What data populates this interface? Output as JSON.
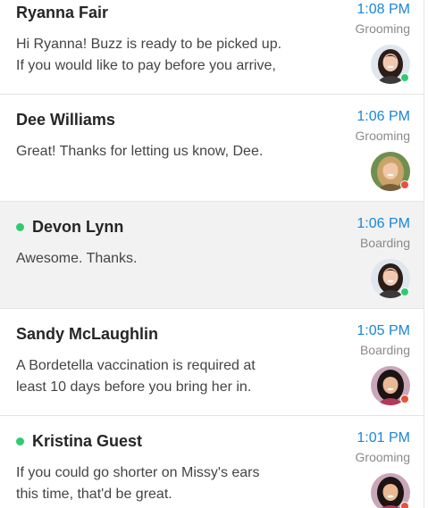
{
  "threads": [
    {
      "name": "Ryanna Fair",
      "time": "1:08 PM",
      "department": "Grooming",
      "message_line1": "Hi Ryanna! Buzz is ready to be picked up.",
      "message_line2": "If you would like to pay before you arrive,",
      "unread": false,
      "presence": "online",
      "skin_color": "#f2c9b0",
      "hair_color": "#2b1d17",
      "bg_color": "#dfe6ee"
    },
    {
      "name": "Dee Williams",
      "time": "1:06 PM",
      "department": "Grooming",
      "message_line1": "Great! Thanks for letting us know, Dee.",
      "message_line2": "",
      "unread": false,
      "presence": "offline",
      "skin_color": "#f0c8a8",
      "hair_color": "#c9a36a",
      "bg_color": "#6f8f4e"
    },
    {
      "name": "Devon Lynn",
      "time": "1:06 PM",
      "department": "Boarding",
      "message_line1": "Awesome. Thanks.",
      "message_line2": "",
      "unread": true,
      "presence": "online",
      "skin_color": "#f2c9b0",
      "hair_color": "#2b1d17",
      "bg_color": "#dfe6ee"
    },
    {
      "name": "Sandy McLaughlin",
      "time": "1:05 PM",
      "department": "Boarding",
      "message_line1": "A Bordetella vaccination is required at",
      "message_line2": "least 10 days before you bring her in.",
      "unread": false,
      "presence": "offline",
      "skin_color": "#e9b894",
      "hair_color": "#1b1413",
      "bg_color": "#c9a7b8"
    },
    {
      "name": "Kristina Guest",
      "time": "1:01 PM",
      "department": "Grooming",
      "message_line1": "If you could go shorter on Missy's ears",
      "message_line2": "this time, that'd be great.",
      "unread": true,
      "presence": "offline",
      "skin_color": "#e9b894",
      "hair_color": "#1b1413",
      "bg_color": "#c9a7b8"
    }
  ],
  "colors": {
    "accent_time": "#1a86d9",
    "unread_dot": "#2ecc71",
    "presence_online": "#2ecc71",
    "presence_offline": "#e5533d",
    "selected_row": "#f2f2f2"
  }
}
